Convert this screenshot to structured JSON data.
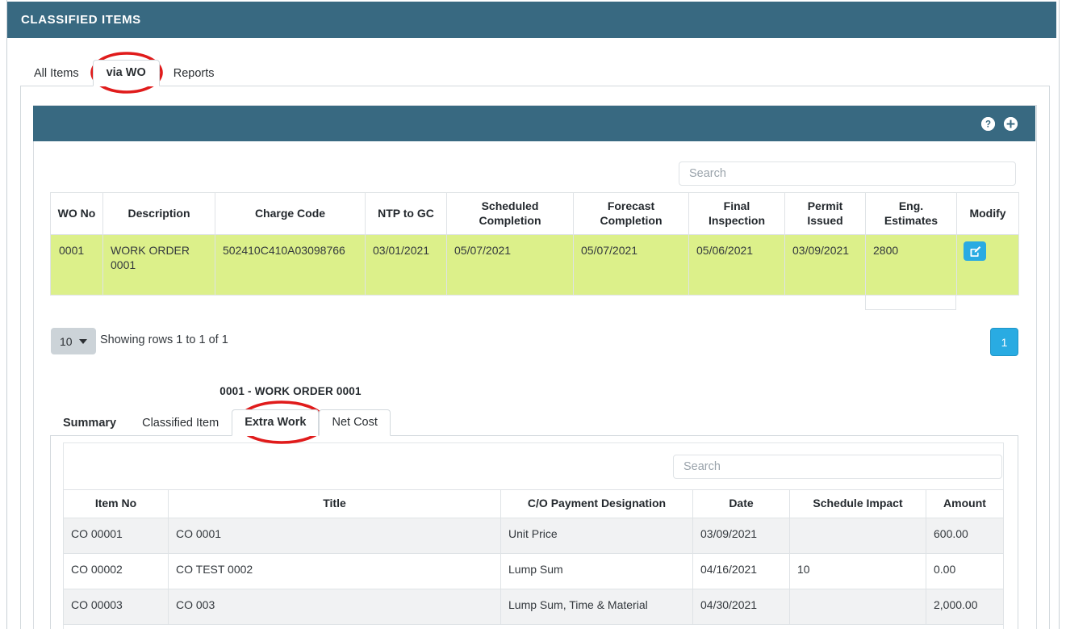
{
  "header": {
    "title": "CLASSIFIED ITEMS"
  },
  "tabs": [
    {
      "label": "All Items",
      "active": false
    },
    {
      "label": "via WO",
      "active": true
    },
    {
      "label": "Reports",
      "active": false
    }
  ],
  "card_actions": [
    {
      "name": "help-icon",
      "label": "?"
    },
    {
      "name": "add-icon",
      "label": "+"
    }
  ],
  "search": {
    "placeholder": "Search",
    "value": ""
  },
  "wo_table": {
    "columns": [
      "WO No",
      "Description",
      "Charge Code",
      "NTP to GC",
      "Scheduled Completion",
      "Forecast Completion",
      "Final Inspection",
      "Permit Issued",
      "Eng. Estimates",
      "Modify"
    ],
    "rows": [
      {
        "wo_no": "0001",
        "description": "WORK ORDER 0001",
        "charge_code": "502410C410A03098766",
        "ntp_to_gc": "03/01/2021",
        "scheduled_completion": "05/07/2021",
        "forecast_completion": "05/07/2021",
        "final_inspection": "05/06/2021",
        "permit_issued": "03/09/2021",
        "eng_estimates": "2800",
        "modify": "edit-icon"
      }
    ]
  },
  "pagination": {
    "page_size": "10",
    "showing": "Showing rows 1 to 1 of 1",
    "current_page": "1"
  },
  "subsection": {
    "title": "0001 - WORK ORDER 0001",
    "tabs": [
      {
        "label": "Summary",
        "style": "bold"
      },
      {
        "label": "Classified Item",
        "style": "plain"
      },
      {
        "label": "Extra Work",
        "style": "boxed-bold"
      },
      {
        "label": "Net Cost",
        "style": "boxed"
      }
    ],
    "search": {
      "placeholder": "Search",
      "value": ""
    }
  },
  "extra_work_table": {
    "columns": [
      "Item No",
      "Title",
      "C/O Payment Designation",
      "Date",
      "Schedule Impact",
      "Amount"
    ],
    "rows": [
      {
        "item_no": "CO 00001",
        "title": "CO 0001",
        "designation": "Unit Price",
        "date": "03/09/2021",
        "schedule_impact": "",
        "amount": "600.00"
      },
      {
        "item_no": "CO 00002",
        "title": "CO TEST 0002",
        "designation": "Lump Sum",
        "date": "04/16/2021",
        "schedule_impact": "10",
        "amount": "0.00"
      },
      {
        "item_no": "CO 00003",
        "title": "CO 003",
        "designation": "Lump Sum, Time & Material",
        "date": "04/30/2021",
        "schedule_impact": "",
        "amount": "2,000.00"
      }
    ]
  },
  "annotations": [
    {
      "name": "annotation-circle-via-wo",
      "target": "via WO"
    },
    {
      "name": "annotation-circle-extra-work",
      "target": "Extra Work"
    }
  ],
  "colors": {
    "header_teal": "#386981",
    "highlight_row": "#dcf08a",
    "accent_blue": "#29abe2",
    "annotation_red": "#e01b1b"
  }
}
